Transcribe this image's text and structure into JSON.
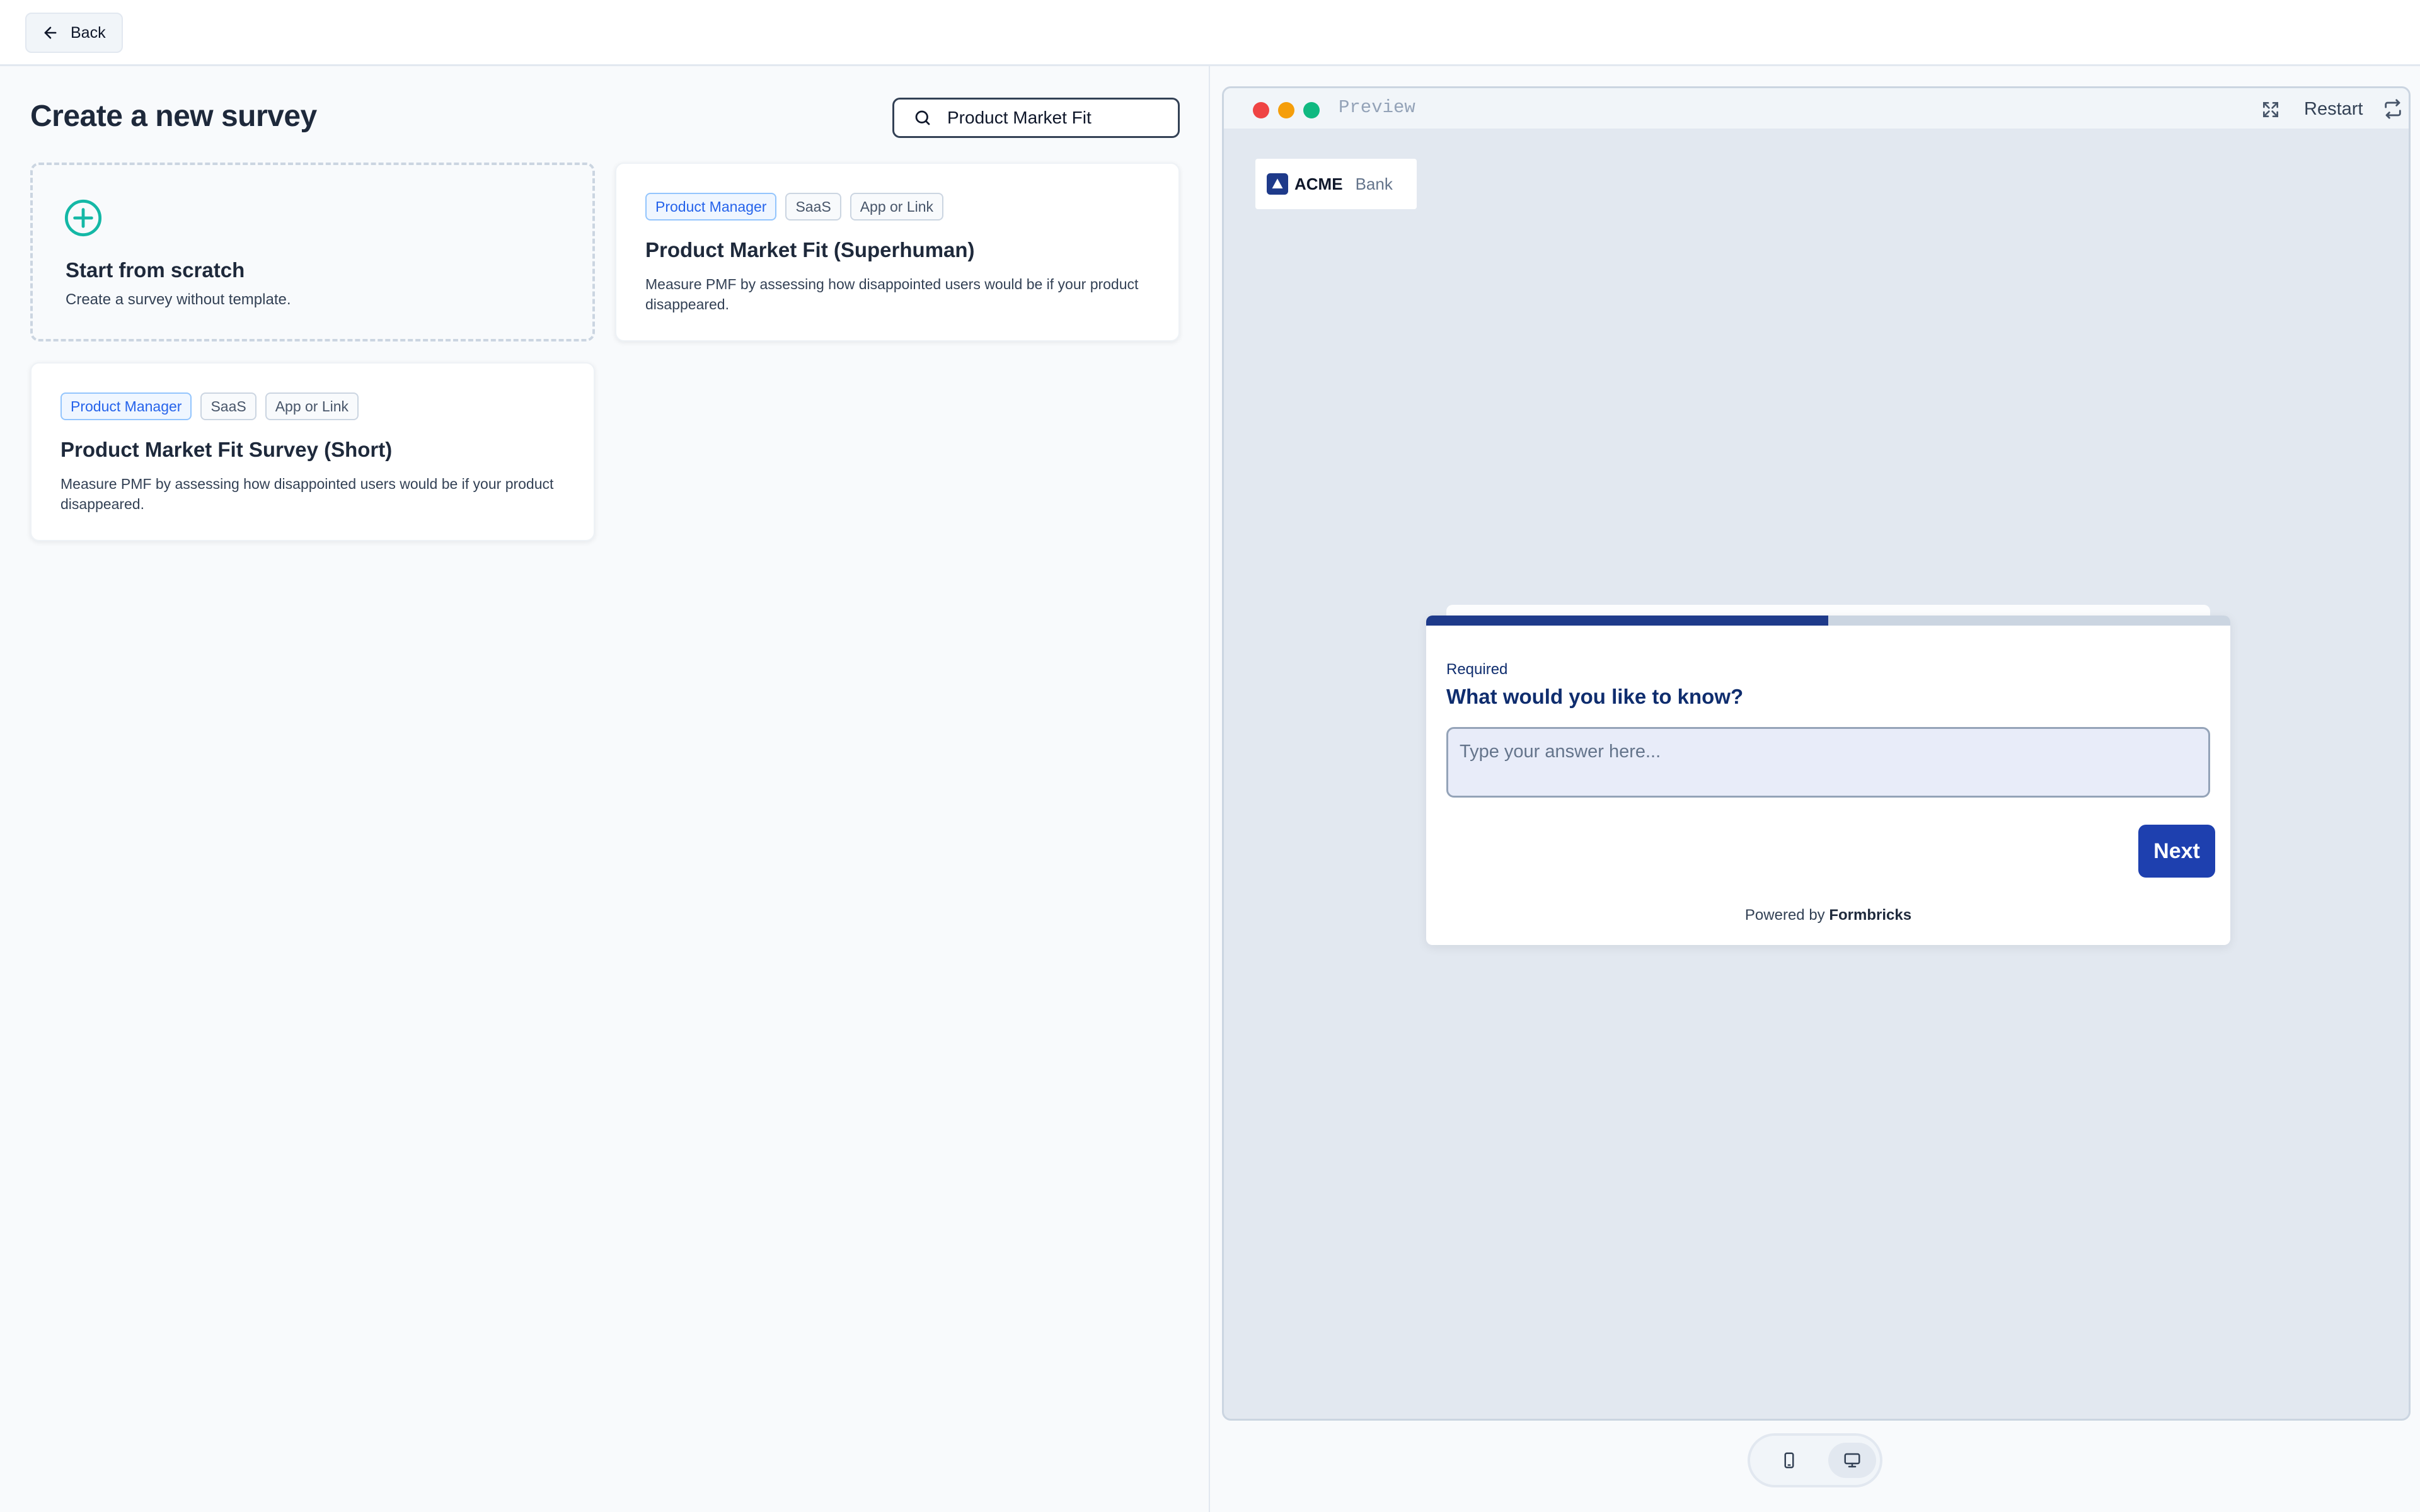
{
  "topbar": {
    "back_label": "Back"
  },
  "left": {
    "title": "Create a new survey",
    "search": {
      "value": "Product Market Fit"
    },
    "scratch": {
      "title": "Start from scratch",
      "desc": "Create a survey without template."
    },
    "templates": [
      {
        "tags": [
          "Product Manager",
          "SaaS",
          "App or Link"
        ],
        "title": "Product Market Fit (Superhuman)",
        "desc": "Measure PMF by assessing how disappointed users would be if your product disappeared."
      },
      {
        "tags": [
          "Product Manager",
          "SaaS",
          "App or Link"
        ],
        "title": "Product Market Fit Survey (Short)",
        "desc": "Measure PMF by assessing how disappointed users would be if your product disappeared."
      }
    ]
  },
  "preview": {
    "label": "Preview",
    "restart_label": "Restart",
    "brand": {
      "name": "ACME",
      "sub": "Bank"
    },
    "progress_fraction": 0.5,
    "question": {
      "required_label": "Required",
      "headline": "What would you like to know?",
      "placeholder": "Type your answer here...",
      "next_label": "Next"
    },
    "powered_by": {
      "prefix": "Powered by",
      "brand": "Formbricks"
    }
  },
  "colors": {
    "accent": "#1e40af",
    "plus_icon": "#14b8a6",
    "tag_primary": "#2563eb"
  },
  "icons": {
    "back": "arrow-left-icon",
    "search": "search-icon",
    "scratch": "plus-circle-icon",
    "expand": "expand-icon",
    "restart": "restart-icon",
    "mobile": "mobile-icon",
    "desktop": "desktop-icon"
  }
}
